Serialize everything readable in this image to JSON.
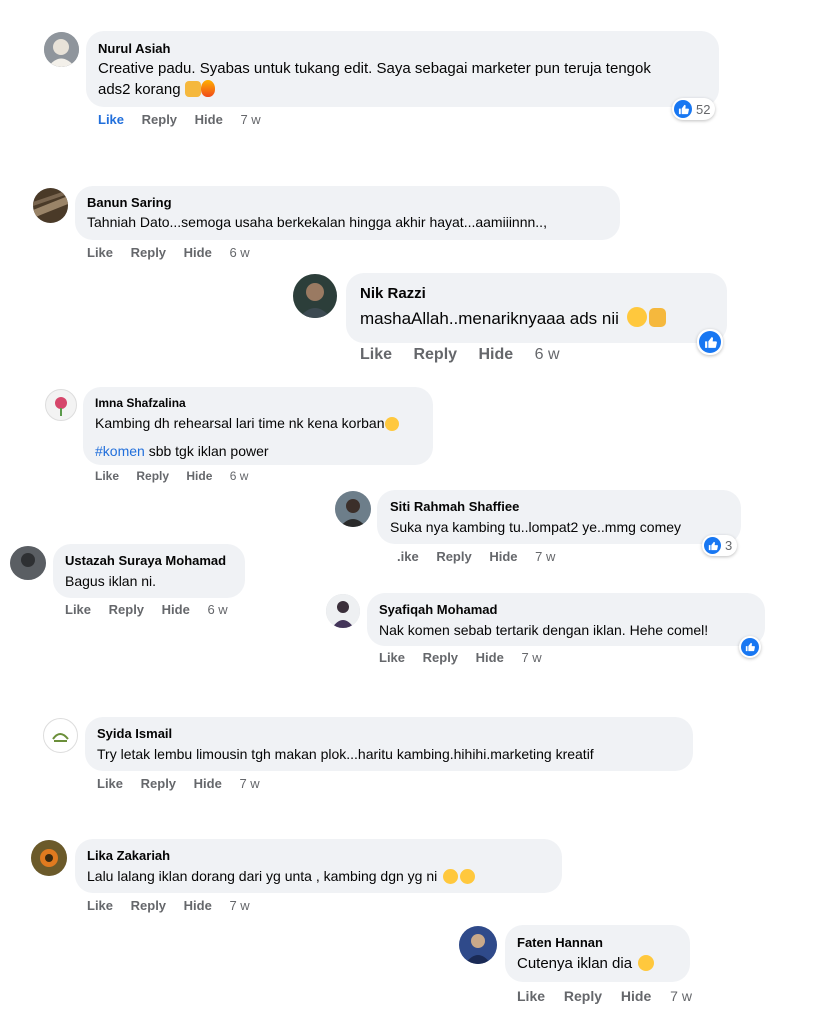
{
  "action_labels": {
    "like": "Like",
    "reply": "Reply",
    "hide": "Hide"
  },
  "comments": [
    {
      "name": "Nurul Asiah",
      "text": "Creative padu. Syabas untuk tukang edit. Saya sebagai marketer pun teruja tengok",
      "text2": "ads2 korang",
      "time": "7 w",
      "reaction_count": "52"
    },
    {
      "name": "Banun Saring",
      "text": "Tahniah Dato...semoga usaha berkekalan hingga akhir hayat...aamiiinnn..,",
      "time": "6 w"
    },
    {
      "name": "Nik Razzi",
      "text": "mashaAllah..menariknyaaa ads nii",
      "time": "6 w"
    },
    {
      "name": "Imna Shafzalina",
      "text": "Kambing dh rehearsal lari time nk kena korban",
      "hashtag": "#komen",
      "text2": " sbb tgk iklan power",
      "time": "6 w"
    },
    {
      "name": "Siti Rahmah Shaffiee",
      "text": "Suka nya kambing tu..lompat2 ye..mmg comey",
      "like_label": ".ike",
      "time": "7 w",
      "reaction_count": "3"
    },
    {
      "name": "Ustazah Suraya Mohamad",
      "text": "Bagus iklan ni.",
      "time": "6 w"
    },
    {
      "name": "Syafiqah Mohamad",
      "text": "Nak komen sebab tertarik dengan iklan. Hehe comel!",
      "time": "7 w"
    },
    {
      "name": "Syida Ismail",
      "text": "Try letak lembu limousin tgh makan plok...haritu kambing.hihihi.marketing kreatif",
      "time": "7 w"
    },
    {
      "name": "Lika Zakariah",
      "text": "Lalu lalang iklan dorang dari yg unta , kambing dgn yg ni",
      "time": "7 w"
    },
    {
      "name": "Faten Hannan",
      "text": "Cutenya iklan dia",
      "time": "7 w"
    }
  ],
  "colors": {
    "bubble": "#f0f2f5",
    "link": "#216fdb",
    "meta": "#65676b",
    "like_badge": "#1877f2"
  }
}
